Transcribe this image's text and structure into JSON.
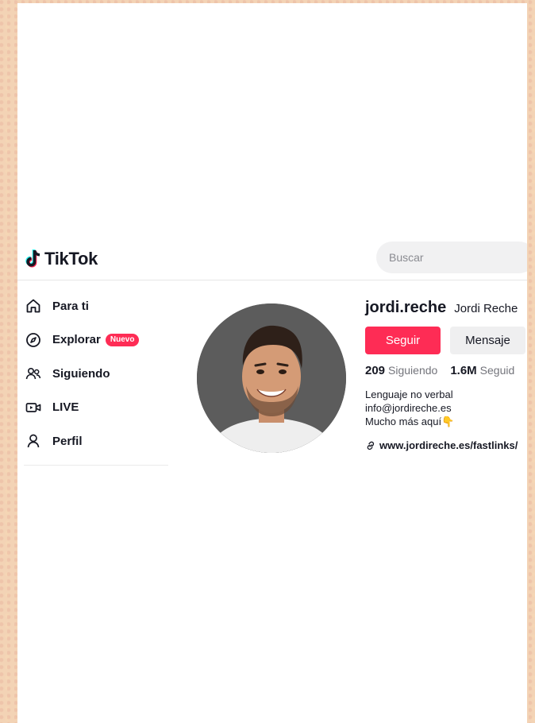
{
  "header": {
    "logo_text": "TikTok",
    "search_placeholder": "Buscar"
  },
  "sidebar": {
    "items": [
      {
        "label": "Para ti",
        "icon": "home-icon"
      },
      {
        "label": "Explorar",
        "icon": "compass-icon",
        "badge": "Nuevo"
      },
      {
        "label": "Siguiendo",
        "icon": "people-icon"
      },
      {
        "label": "LIVE",
        "icon": "live-icon"
      },
      {
        "label": "Perfil",
        "icon": "person-icon"
      }
    ]
  },
  "profile": {
    "username": "jordi.reche",
    "nickname": "Jordi Reche",
    "follow_label": "Seguir",
    "message_label": "Mensaje",
    "following_count": "209",
    "following_label": "Siguiendo",
    "followers_count": "1.6M",
    "followers_label": "Seguid",
    "bio_lines": [
      "Lenguaje no verbal",
      "info@jordireche.es",
      "Mucho más aquí👇"
    ],
    "link": "www.jordireche.es/fastlinks/"
  },
  "colors": {
    "accent": "#fe2c55",
    "text": "#161823",
    "muted": "#73747b"
  }
}
